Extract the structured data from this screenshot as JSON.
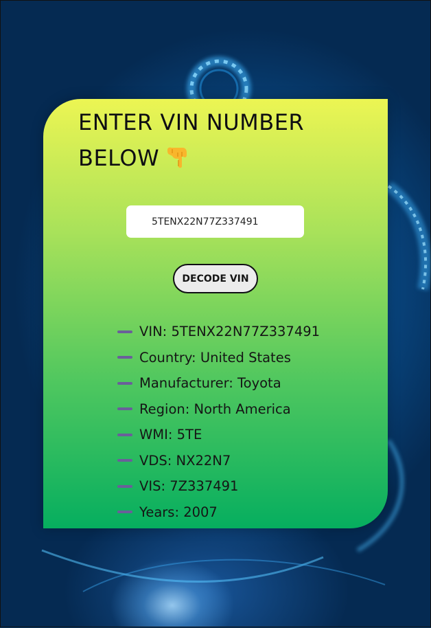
{
  "heading": {
    "title": "ENTER VIN NUMBER BELOW",
    "icon": "pointing-down-hand-icon"
  },
  "form": {
    "vin_value": "5TENX22N77Z337491",
    "decode_label": "DECODE VIN"
  },
  "results": [
    {
      "label": "VIN: 5TENX22N77Z337491"
    },
    {
      "label": "Country: United States"
    },
    {
      "label": "Manufacturer: Toyota"
    },
    {
      "label": "Region: North America"
    },
    {
      "label": "WMI: 5TE"
    },
    {
      "label": "VDS: NX22N7"
    },
    {
      "label": "VIS: 7Z337491"
    },
    {
      "label": "Years: 2007"
    }
  ],
  "colors": {
    "card_top": "#ecf553",
    "card_bottom": "#06ae5f",
    "bullet": "#6a5f9a",
    "background": "#0a4d8c"
  }
}
